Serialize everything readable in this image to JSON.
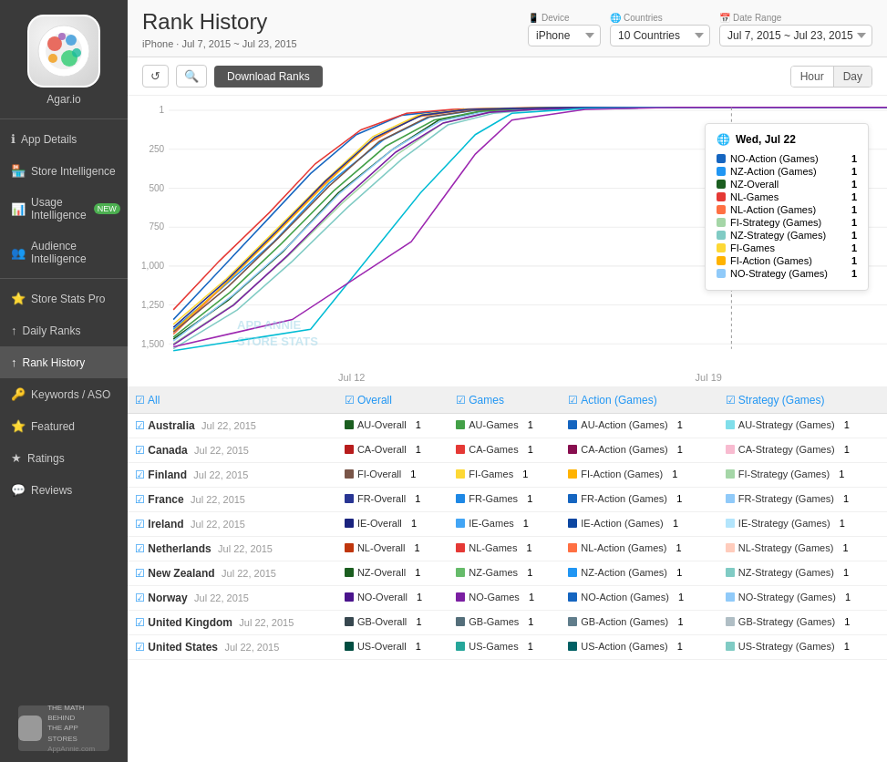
{
  "app": {
    "name": "Agar.io",
    "logo_colors": [
      "#e74c3c",
      "#3498db",
      "#2ecc71",
      "#f39c12",
      "#9b59b6",
      "#1abc9c"
    ]
  },
  "sidebar": {
    "items": [
      {
        "id": "app-details",
        "label": "App Details",
        "icon": "ℹ",
        "active": false
      },
      {
        "id": "store-intelligence",
        "label": "Store Intelligence",
        "icon": "🏪",
        "active": false
      },
      {
        "id": "usage-intelligence",
        "label": "Usage Intelligence",
        "icon": "📊",
        "badge": "NEW",
        "active": false
      },
      {
        "id": "audience-intelligence",
        "label": "Audience Intelligence",
        "icon": "👥",
        "active": false
      },
      {
        "id": "store-stats-pro",
        "label": "Store Stats Pro",
        "icon": "⭐",
        "active": false
      },
      {
        "id": "daily-ranks",
        "label": "Daily Ranks",
        "icon": "↑",
        "active": false
      },
      {
        "id": "rank-history",
        "label": "Rank History",
        "icon": "↑",
        "active": true
      },
      {
        "id": "keywords-aso",
        "label": "Keywords / ASO",
        "icon": "🔑",
        "active": false
      },
      {
        "id": "featured",
        "label": "Featured",
        "icon": "⭐",
        "active": false
      },
      {
        "id": "ratings",
        "label": "Ratings",
        "icon": "★",
        "active": false
      },
      {
        "id": "reviews",
        "label": "Reviews",
        "icon": "💬",
        "active": false
      }
    ],
    "footer_text": "THE MATH BEHIND\nTHE APP STORES\nAppAnnie.com"
  },
  "header": {
    "title": "Rank History",
    "subtitle": "iPhone · Jul 7, 2015 ~ Jul 23, 2015",
    "device_label": "Device",
    "device_value": "iPhone",
    "countries_label": "Countries",
    "countries_value": "10 Countries",
    "date_label": "Date Range",
    "date_value": "Jul 7, 2015 ~ Jul 23, 2015"
  },
  "toolbar": {
    "download_label": "Download Ranks",
    "hour_label": "Hour",
    "day_label": "Day"
  },
  "chart": {
    "xaxis": [
      "Jul 12",
      "Jul 19"
    ],
    "yaxis": [
      "1",
      "250",
      "500",
      "750",
      "1,000",
      "1,250",
      "1,500"
    ],
    "watermark_line1": "App Annie",
    "watermark_line2": "Store Stats"
  },
  "tooltip": {
    "date": "Wed, Jul 22",
    "rows": [
      {
        "label": "NO-Action (Games)",
        "color": "#1565C0",
        "val": "1"
      },
      {
        "label": "NZ-Action (Games)",
        "color": "#2196F3",
        "val": "1"
      },
      {
        "label": "NZ-Overall",
        "color": "#1B5E20",
        "val": "1"
      },
      {
        "label": "NL-Games",
        "color": "#E53935",
        "val": "1"
      },
      {
        "label": "NL-Action (Games)",
        "color": "#FF7043",
        "val": "1"
      },
      {
        "label": "FI-Strategy (Games)",
        "color": "#A5D6A7",
        "val": "1"
      },
      {
        "label": "NZ-Strategy (Games)",
        "color": "#80CBC4",
        "val": "1"
      },
      {
        "label": "FI-Games",
        "color": "#FDD835",
        "val": "1"
      },
      {
        "label": "FI-Action (Games)",
        "color": "#FFB300",
        "val": "1"
      },
      {
        "label": "NO-Strategy (Games)",
        "color": "#90CAF9",
        "val": "1"
      }
    ]
  },
  "table": {
    "headers": [
      "All",
      "Overall",
      "Games",
      "Action (Games)",
      "Strategy (Games)"
    ],
    "rows": [
      {
        "country": "Australia",
        "date": "Jul 22, 2015",
        "overall": {
          "label": "AU-Overall",
          "color": "#1B5E20"
        },
        "overall_rank": "1",
        "games": {
          "label": "AU-Games",
          "color": "#43A047"
        },
        "games_rank": "1",
        "action": {
          "label": "AU-Action (Games)",
          "color": "#1565C0"
        },
        "action_rank": "1",
        "strategy": {
          "label": "AU-Strategy (Games)",
          "color": "#80DEEA"
        },
        "strategy_rank": "1"
      },
      {
        "country": "Canada",
        "date": "Jul 22, 2015",
        "overall": {
          "label": "CA-Overall",
          "color": "#B71C1C"
        },
        "overall_rank": "1",
        "games": {
          "label": "CA-Games",
          "color": "#E53935"
        },
        "games_rank": "1",
        "action": {
          "label": "CA-Action (Games)",
          "color": "#880E4F"
        },
        "action_rank": "1",
        "strategy": {
          "label": "CA-Strategy (Games)",
          "color": "#F8BBD0"
        },
        "strategy_rank": "1"
      },
      {
        "country": "Finland",
        "date": "Jul 22, 2015",
        "overall": {
          "label": "FI-Overall",
          "color": "#795548"
        },
        "overall_rank": "1",
        "games": {
          "label": "FI-Games",
          "color": "#FDD835"
        },
        "games_rank": "1",
        "action": {
          "label": "FI-Action (Games)",
          "color": "#FFB300"
        },
        "action_rank": "1",
        "strategy": {
          "label": "FI-Strategy (Games)",
          "color": "#A5D6A7"
        },
        "strategy_rank": "1"
      },
      {
        "country": "France",
        "date": "Jul 22, 2015",
        "overall": {
          "label": "FR-Overall",
          "color": "#283593"
        },
        "overall_rank": "1",
        "games": {
          "label": "FR-Games",
          "color": "#1E88E5"
        },
        "games_rank": "1",
        "action": {
          "label": "FR-Action (Games)",
          "color": "#1565C0"
        },
        "action_rank": "1",
        "strategy": {
          "label": "FR-Strategy (Games)",
          "color": "#90CAF9"
        },
        "strategy_rank": "1"
      },
      {
        "country": "Ireland",
        "date": "Jul 22, 2015",
        "overall": {
          "label": "IE-Overall",
          "color": "#1A237E"
        },
        "overall_rank": "1",
        "games": {
          "label": "IE-Games",
          "color": "#42A5F5"
        },
        "games_rank": "1",
        "action": {
          "label": "IE-Action (Games)",
          "color": "#0D47A1"
        },
        "action_rank": "1",
        "strategy": {
          "label": "IE-Strategy (Games)",
          "color": "#B3E5FC"
        },
        "strategy_rank": "1"
      },
      {
        "country": "Netherlands",
        "date": "Jul 22, 2015",
        "overall": {
          "label": "NL-Overall",
          "color": "#BF360C"
        },
        "overall_rank": "1",
        "games": {
          "label": "NL-Games",
          "color": "#E53935"
        },
        "games_rank": "1",
        "action": {
          "label": "NL-Action (Games)",
          "color": "#FF7043"
        },
        "action_rank": "1",
        "strategy": {
          "label": "NL-Strategy (Games)",
          "color": "#FFCCBC"
        },
        "strategy_rank": "1"
      },
      {
        "country": "New Zealand",
        "date": "Jul 22, 2015",
        "overall": {
          "label": "NZ-Overall",
          "color": "#1B5E20"
        },
        "overall_rank": "1",
        "games": {
          "label": "NZ-Games",
          "color": "#66BB6A"
        },
        "games_rank": "1",
        "action": {
          "label": "NZ-Action (Games)",
          "color": "#2196F3"
        },
        "action_rank": "1",
        "strategy": {
          "label": "NZ-Strategy (Games)",
          "color": "#80CBC4"
        },
        "strategy_rank": "1"
      },
      {
        "country": "Norway",
        "date": "Jul 22, 2015",
        "overall": {
          "label": "NO-Overall",
          "color": "#4A148C"
        },
        "overall_rank": "1",
        "games": {
          "label": "NO-Games",
          "color": "#7B1FA2"
        },
        "games_rank": "1",
        "action": {
          "label": "NO-Action (Games)",
          "color": "#1565C0"
        },
        "action_rank": "1",
        "strategy": {
          "label": "NO-Strategy (Games)",
          "color": "#90CAF9"
        },
        "strategy_rank": "1"
      },
      {
        "country": "United Kingdom",
        "date": "Jul 22, 2015",
        "overall": {
          "label": "GB-Overall",
          "color": "#37474F"
        },
        "overall_rank": "1",
        "games": {
          "label": "GB-Games",
          "color": "#546E7A"
        },
        "games_rank": "1",
        "action": {
          "label": "GB-Action (Games)",
          "color": "#607D8B"
        },
        "action_rank": "1",
        "strategy": {
          "label": "GB-Strategy (Games)",
          "color": "#B0BEC5"
        },
        "strategy_rank": "1"
      },
      {
        "country": "United States",
        "date": "Jul 22, 2015",
        "overall": {
          "label": "US-Overall",
          "color": "#004D40"
        },
        "overall_rank": "1",
        "games": {
          "label": "US-Games",
          "color": "#26A69A"
        },
        "games_rank": "1",
        "action": {
          "label": "US-Action (Games)",
          "color": "#006064"
        },
        "action_rank": "1",
        "strategy": {
          "label": "US-Strategy (Games)",
          "color": "#80CBC4"
        },
        "strategy_rank": "1"
      }
    ]
  }
}
